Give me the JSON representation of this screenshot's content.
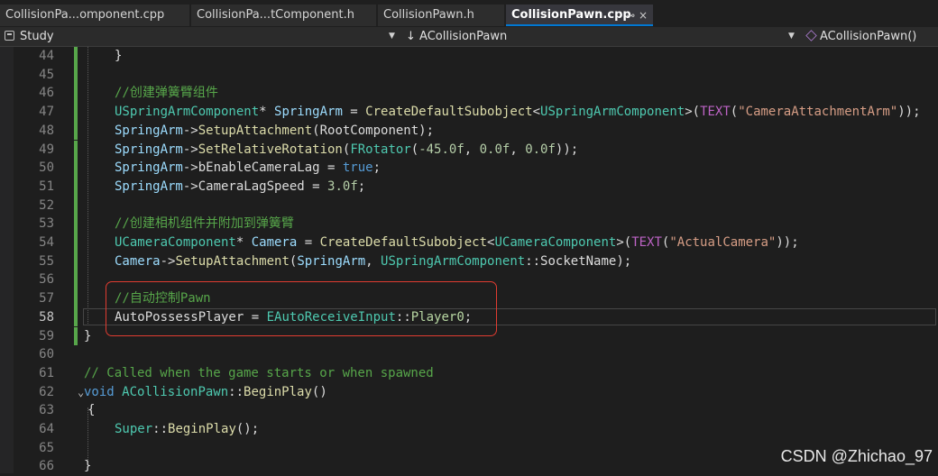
{
  "tabs": [
    {
      "label": "CollisionPa...omponent.cpp",
      "active": false
    },
    {
      "label": "CollisionPa...tComponent.h",
      "active": false
    },
    {
      "label": "CollisionPawn.h",
      "active": false
    },
    {
      "label": "CollisionPawn.cpp",
      "active": true,
      "pin": "⊸",
      "close": "×"
    }
  ],
  "navbar": {
    "project": "Study",
    "scope": "↓ ACollisionPawn",
    "member": "ACollisionPawn()"
  },
  "line_numbers": [
    "44",
    "45",
    "46",
    "47",
    "48",
    "49",
    "50",
    "51",
    "52",
    "53",
    "54",
    "55",
    "56",
    "57",
    "58",
    "59",
    "60",
    "61",
    "62",
    "63",
    "64",
    "65",
    "66"
  ],
  "current_line": "58",
  "code": {
    "l44": "}",
    "l46": "//创建弹簧臂组件",
    "l47": {
      "t1": "USpringArmComponent",
      "p1": "* ",
      "v1": "SpringArm",
      "p2": " = ",
      "f1": "CreateDefaultSubobject",
      "p3": "<",
      "t2": "USpringArmComponent",
      "p4": ">(",
      "m1": "TEXT",
      "p5": "(",
      "s1": "\"CameraAttachmentArm\"",
      "p6": "));"
    },
    "l48": {
      "v1": "SpringArm",
      "p1": "->",
      "f1": "SetupAttachment",
      "p2": "(",
      "v2": "RootComponent",
      "p3": ");"
    },
    "l49": {
      "v1": "SpringArm",
      "p1": "->",
      "f1": "SetRelativeRotation",
      "p2": "(",
      "t1": "FRotator",
      "p3": "(",
      "n1": "-45.0f",
      "p4": ", ",
      "n2": "0.0f",
      "p5": ", ",
      "n3": "0.0f",
      "p6": "));"
    },
    "l50": {
      "v1": "SpringArm",
      "p1": "->",
      "v2": "bEnableCameraLag",
      "p2": " = ",
      "k1": "true",
      "p3": ";"
    },
    "l51": {
      "v1": "SpringArm",
      "p1": "->",
      "v2": "CameraLagSpeed",
      "p2": " = ",
      "n1": "3.0f",
      "p3": ";"
    },
    "l53": "//创建相机组件并附加到弹簧臂",
    "l54": {
      "t1": "UCameraComponent",
      "p1": "* ",
      "v1": "Camera",
      "p2": " = ",
      "f1": "CreateDefaultSubobject",
      "p3": "<",
      "t2": "UCameraComponent",
      "p4": ">(",
      "m1": "TEXT",
      "p5": "(",
      "s1": "\"ActualCamera\"",
      "p6": "));"
    },
    "l55": {
      "v1": "Camera",
      "p1": "->",
      "f1": "SetupAttachment",
      "p2": "(",
      "v2": "SpringArm",
      "p3": ", ",
      "t1": "USpringArmComponent",
      "p4": "::",
      "v3": "SocketName",
      "p5": ");"
    },
    "l57": "//自动控制Pawn",
    "l58": {
      "v1": "AutoPossessPlayer",
      "p1": " = ",
      "t1": "EAutoReceiveInput",
      "p2": "::",
      "e1": "Player0",
      "p3": ";"
    },
    "l59": "}",
    "l61": "// Called when the game starts or when spawned",
    "l62": {
      "k1": "void",
      "p0": " ",
      "t1": "ACollisionPawn",
      "p1": "::",
      "f1": "BeginPlay",
      "p2": "()"
    },
    "l63": "{",
    "l64": {
      "t1": "Super",
      "p1": "::",
      "f1": "BeginPlay",
      "p2": "();"
    },
    "l66": "}"
  },
  "watermark": "CSDN @Zhichao_97",
  "colors": {
    "keyword": "#569cd6",
    "type": "#4ec9b0",
    "function": "#dcdcaa",
    "variable": "#9cdcfe",
    "string": "#d69d85",
    "number": "#b5cea8",
    "comment": "#57a64a",
    "macro": "#bd63c5",
    "enum": "#b8d7a3",
    "highlight_box": "#e03c31"
  }
}
